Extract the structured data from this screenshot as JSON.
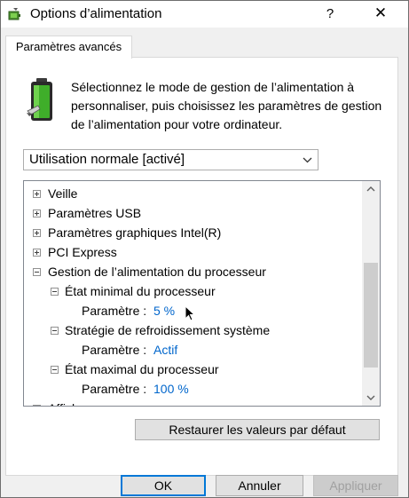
{
  "window": {
    "title": "Options d’alimentation",
    "help_label": "?",
    "close_label": "✕"
  },
  "tab": {
    "label": "Paramètres avancés"
  },
  "description": "Sélectionnez le mode de gestion de l’alimentation à personnaliser, puis choisissez les paramètres de gestion de l’alimentation pour votre ordinateur.",
  "scheme_select": {
    "value": "Utilisation normale [activé]"
  },
  "tree": {
    "items": [
      {
        "label": "Veille",
        "state": "collapsed"
      },
      {
        "label": "Paramètres USB",
        "state": "collapsed"
      },
      {
        "label": "Paramètres graphiques Intel(R)",
        "state": "collapsed"
      },
      {
        "label": "PCI Express",
        "state": "collapsed"
      },
      {
        "label": "Gestion de l’alimentation du processeur",
        "state": "expanded"
      },
      {
        "label": "État minimal du processeur",
        "state": "expanded"
      },
      {
        "label": "Paramètre :",
        "value": "5  %"
      },
      {
        "label": "Stratégie de refroidissement système",
        "state": "expanded"
      },
      {
        "label": "Paramètre :",
        "value": "Actif"
      },
      {
        "label": "État maximal du processeur",
        "state": "expanded"
      },
      {
        "label": "Paramètre :",
        "value": "100  %"
      },
      {
        "label": "Affichage",
        "state": "collapsed"
      }
    ]
  },
  "buttons": {
    "restore": "Restaurer les valeurs par défaut",
    "ok": "OK",
    "cancel": "Annuler",
    "apply": "Appliquer"
  },
  "colors": {
    "value_text": "#0066cc",
    "focus_border": "#0078d7",
    "battery_green": "#3fae2a"
  }
}
